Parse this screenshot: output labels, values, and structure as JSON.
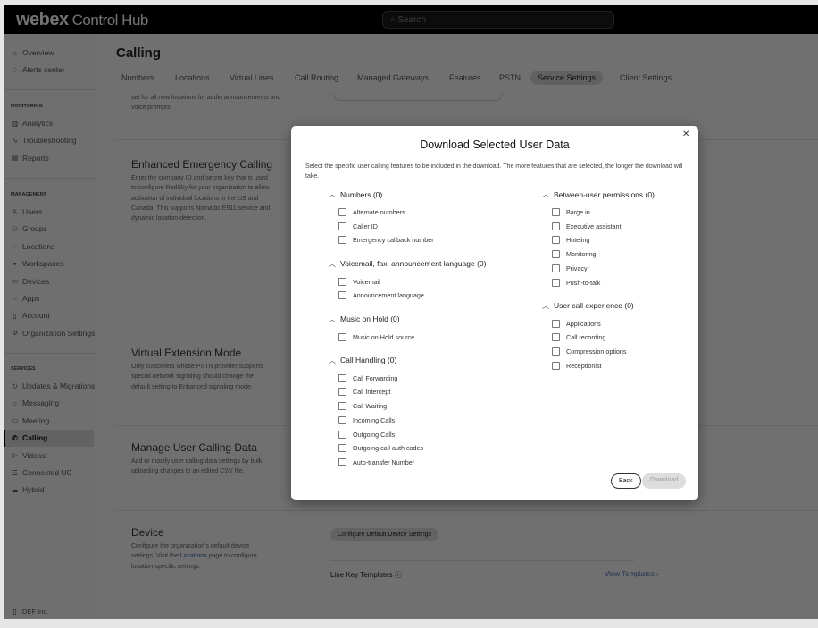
{
  "header": {
    "brand": "webex",
    "product": "Control Hub",
    "search_placeholder": "Search"
  },
  "sidebar": {
    "top": [
      {
        "label": "Overview",
        "icon": "home-icon"
      },
      {
        "label": "Alerts center",
        "icon": "bell-icon"
      }
    ],
    "monitoring_title": "MONITORING",
    "monitoring": [
      {
        "label": "Analytics",
        "icon": "chart-icon"
      },
      {
        "label": "Troubleshooting",
        "icon": "pulse-icon"
      },
      {
        "label": "Reports",
        "icon": "report-icon"
      }
    ],
    "management_title": "MANAGEMENT",
    "management": [
      {
        "label": "Users",
        "icon": "user-icon"
      },
      {
        "label": "Groups",
        "icon": "group-icon"
      },
      {
        "label": "Locations",
        "icon": "location-icon"
      },
      {
        "label": "Workspaces",
        "icon": "workspace-icon"
      },
      {
        "label": "Devices",
        "icon": "device-icon"
      },
      {
        "label": "Apps",
        "icon": "apps-icon"
      },
      {
        "label": "Account",
        "icon": "account-icon"
      },
      {
        "label": "Organization Settings",
        "icon": "gear-icon"
      }
    ],
    "services_title": "SERVICES",
    "services": [
      {
        "label": "Updates & Migrations",
        "icon": "refresh-icon"
      },
      {
        "label": "Messaging",
        "icon": "message-icon"
      },
      {
        "label": "Meeting",
        "icon": "meeting-icon"
      },
      {
        "label": "Calling",
        "icon": "phone-icon",
        "active": true
      },
      {
        "label": "Vidcast",
        "icon": "play-icon"
      },
      {
        "label": "Connected UC",
        "icon": "stack-icon"
      },
      {
        "label": "Hybrid",
        "icon": "cloud-icon"
      }
    ],
    "org": "DEF Inc."
  },
  "main": {
    "title": "Calling",
    "tabs": [
      "Numbers",
      "Locations",
      "Virtual Lines",
      "Call Routing",
      "Managed Gateways",
      "Features",
      "PSTN",
      "Service Settings",
      "Client Settings"
    ],
    "active_tab": "Service Settings",
    "partial_text": "set for all new locations for audio announcements and voice prompts.",
    "sections": [
      {
        "title": "Enhanced Emergency Calling",
        "desc": "Enter the company ID and secret key that is used to configure RedSky for your organization to allow activation of individual locations in the US and Canada. This supports Nomadic E911 service and dynamic location detection."
      },
      {
        "title": "Virtual Extension Mode",
        "desc": "Only customers whose PSTN provider supports special network signaling should change the default setting to Enhanced signaling mode."
      },
      {
        "title": "Manage User Calling Data",
        "desc": "Add or modify user calling data settings by bulk uploading changes to an edited CSV file."
      },
      {
        "title": "Device",
        "desc_pre": "Configure the organization's default device settings. Visit the ",
        "desc_link": "Locations",
        "desc_post": " page to configure location-specific settings."
      }
    ],
    "device_button": "Configure Default Device Settings",
    "line_key_label": "Line Key Templates",
    "view_templates": "View Templates"
  },
  "modal": {
    "title": "Download Selected User Data",
    "description": "Select the specific user calling features to be included in the download. The more features that are selected, the longer the download will take.",
    "left_groups": [
      {
        "label": "Numbers (0)",
        "items": [
          "Alternate numbers",
          "Caller ID",
          "Emergency callback number"
        ]
      },
      {
        "label": "Voicemail, fax, announcement language (0)",
        "items": [
          "Voicemail",
          "Announcement language"
        ]
      },
      {
        "label": "Music on Hold (0)",
        "items": [
          "Music on Hold source"
        ]
      },
      {
        "label": "Call Handling (0)",
        "items": [
          "Call Forwarding",
          "Call Intercept",
          "Call Waiting",
          "Incoming Calls",
          "Outgoing Calls",
          "Outgoing call auth codes",
          "Auto-transfer Number"
        ]
      }
    ],
    "right_groups": [
      {
        "label": "Between-user permissions (0)",
        "items": [
          "Barge in",
          "Executive assistant",
          "Hoteling",
          "Monitoring",
          "Privacy",
          "Push-to-talk"
        ]
      },
      {
        "label": "User call experience (0)",
        "items": [
          "Applications",
          "Call recording",
          "Compression options",
          "Receptionist"
        ]
      }
    ],
    "back": "Back",
    "download": "Download"
  }
}
